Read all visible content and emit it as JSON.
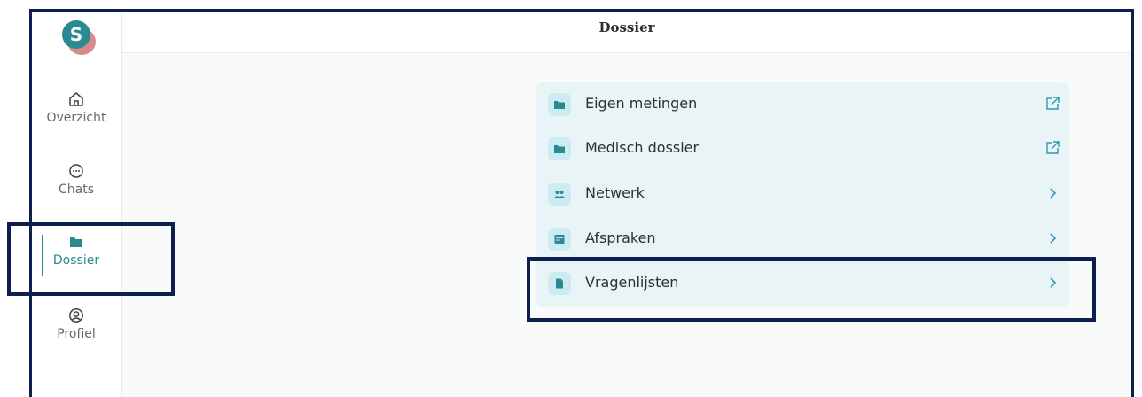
{
  "app": {
    "logo_letter": "S"
  },
  "header": {
    "title": "Dossier"
  },
  "sidebar": {
    "items": [
      {
        "label": "Overzicht",
        "icon": "home-icon"
      },
      {
        "label": "Chats",
        "icon": "chat-icon"
      },
      {
        "label": "Dossier",
        "icon": "folder-icon",
        "active": true
      },
      {
        "label": "Profiel",
        "icon": "user-circle-icon"
      }
    ]
  },
  "dossier": {
    "rows": [
      {
        "label": "Eigen metingen",
        "icon": "folder-icon",
        "trailing": "external-link-icon"
      },
      {
        "label": "Medisch dossier",
        "icon": "folder-icon",
        "trailing": "external-link-icon"
      },
      {
        "label": "Netwerk",
        "icon": "people-icon",
        "trailing": "chevron-right-icon"
      },
      {
        "label": "Afspraken",
        "icon": "calendar-icon",
        "trailing": "chevron-right-icon"
      },
      {
        "label": "Vragenlijsten",
        "icon": "document-icon",
        "trailing": "chevron-right-icon"
      }
    ]
  },
  "colors": {
    "accent": "#2a8a91",
    "highlight_border": "#0e1f4f",
    "panel_bg": "#e9f4f6",
    "icon_tile": "#cdecf2"
  }
}
